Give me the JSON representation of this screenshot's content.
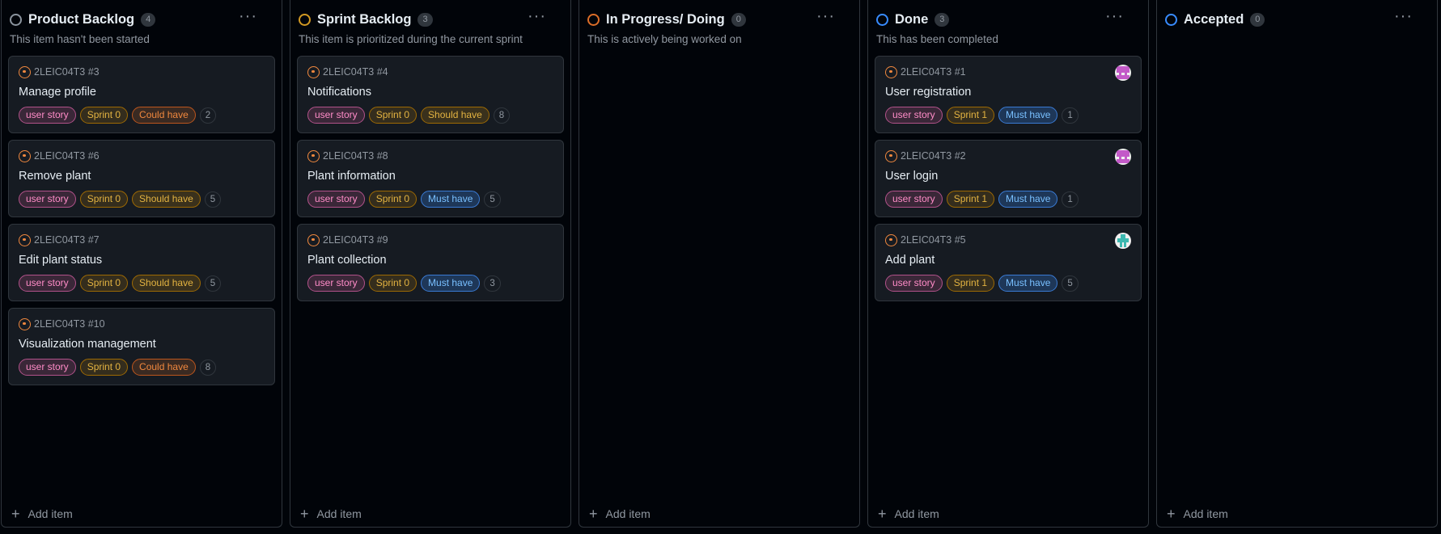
{
  "colors": {
    "backlog": "#8b949e",
    "sprint": "#d29922",
    "in_progress": "#db6d28",
    "done": "#388bfd",
    "accepted": "#388bfd"
  },
  "add_item_label": "Add item",
  "columns": [
    {
      "title": "Product Backlog",
      "count": "4",
      "description": "This item hasn't been started",
      "cards": [
        {
          "ref": "2LEIC04T3 #3",
          "title": "Manage profile",
          "type": "user story",
          "sprint": "Sprint 0",
          "priority": "Could have",
          "estimate": "2"
        },
        {
          "ref": "2LEIC04T3 #6",
          "title": "Remove plant",
          "type": "user story",
          "sprint": "Sprint 0",
          "priority": "Should have",
          "estimate": "5"
        },
        {
          "ref": "2LEIC04T3 #7",
          "title": "Edit plant status",
          "type": "user story",
          "sprint": "Sprint 0",
          "priority": "Should have",
          "estimate": "5"
        },
        {
          "ref": "2LEIC04T3 #10",
          "title": "Visualization management",
          "type": "user story",
          "sprint": "Sprint 0",
          "priority": "Could have",
          "estimate": "8"
        }
      ]
    },
    {
      "title": "Sprint Backlog",
      "count": "3",
      "description": "This item is prioritized during the current sprint",
      "cards": [
        {
          "ref": "2LEIC04T3 #4",
          "title": "Notifications",
          "type": "user story",
          "sprint": "Sprint 0",
          "priority": "Should have",
          "estimate": "8"
        },
        {
          "ref": "2LEIC04T3 #8",
          "title": "Plant information",
          "type": "user story",
          "sprint": "Sprint 0",
          "priority": "Must have",
          "estimate": "5"
        },
        {
          "ref": "2LEIC04T3 #9",
          "title": "Plant collection",
          "type": "user story",
          "sprint": "Sprint 0",
          "priority": "Must have",
          "estimate": "3"
        }
      ]
    },
    {
      "title": "In Progress/ Doing",
      "count": "0",
      "description": "This is actively being worked on",
      "cards": []
    },
    {
      "title": "Done",
      "count": "3",
      "description": "This has been completed",
      "cards": [
        {
          "ref": "2LEIC04T3 #1",
          "title": "User registration",
          "type": "user story",
          "sprint": "Sprint 1",
          "priority": "Must have",
          "estimate": "1"
        },
        {
          "ref": "2LEIC04T3 #2",
          "title": "User login",
          "type": "user story",
          "sprint": "Sprint 1",
          "priority": "Must have",
          "estimate": "1"
        },
        {
          "ref": "2LEIC04T3 #5",
          "title": "Add plant",
          "type": "user story",
          "sprint": "Sprint 1",
          "priority": "Must have",
          "estimate": "5"
        }
      ]
    },
    {
      "title": "Accepted",
      "count": "0",
      "description": "",
      "cards": []
    }
  ]
}
